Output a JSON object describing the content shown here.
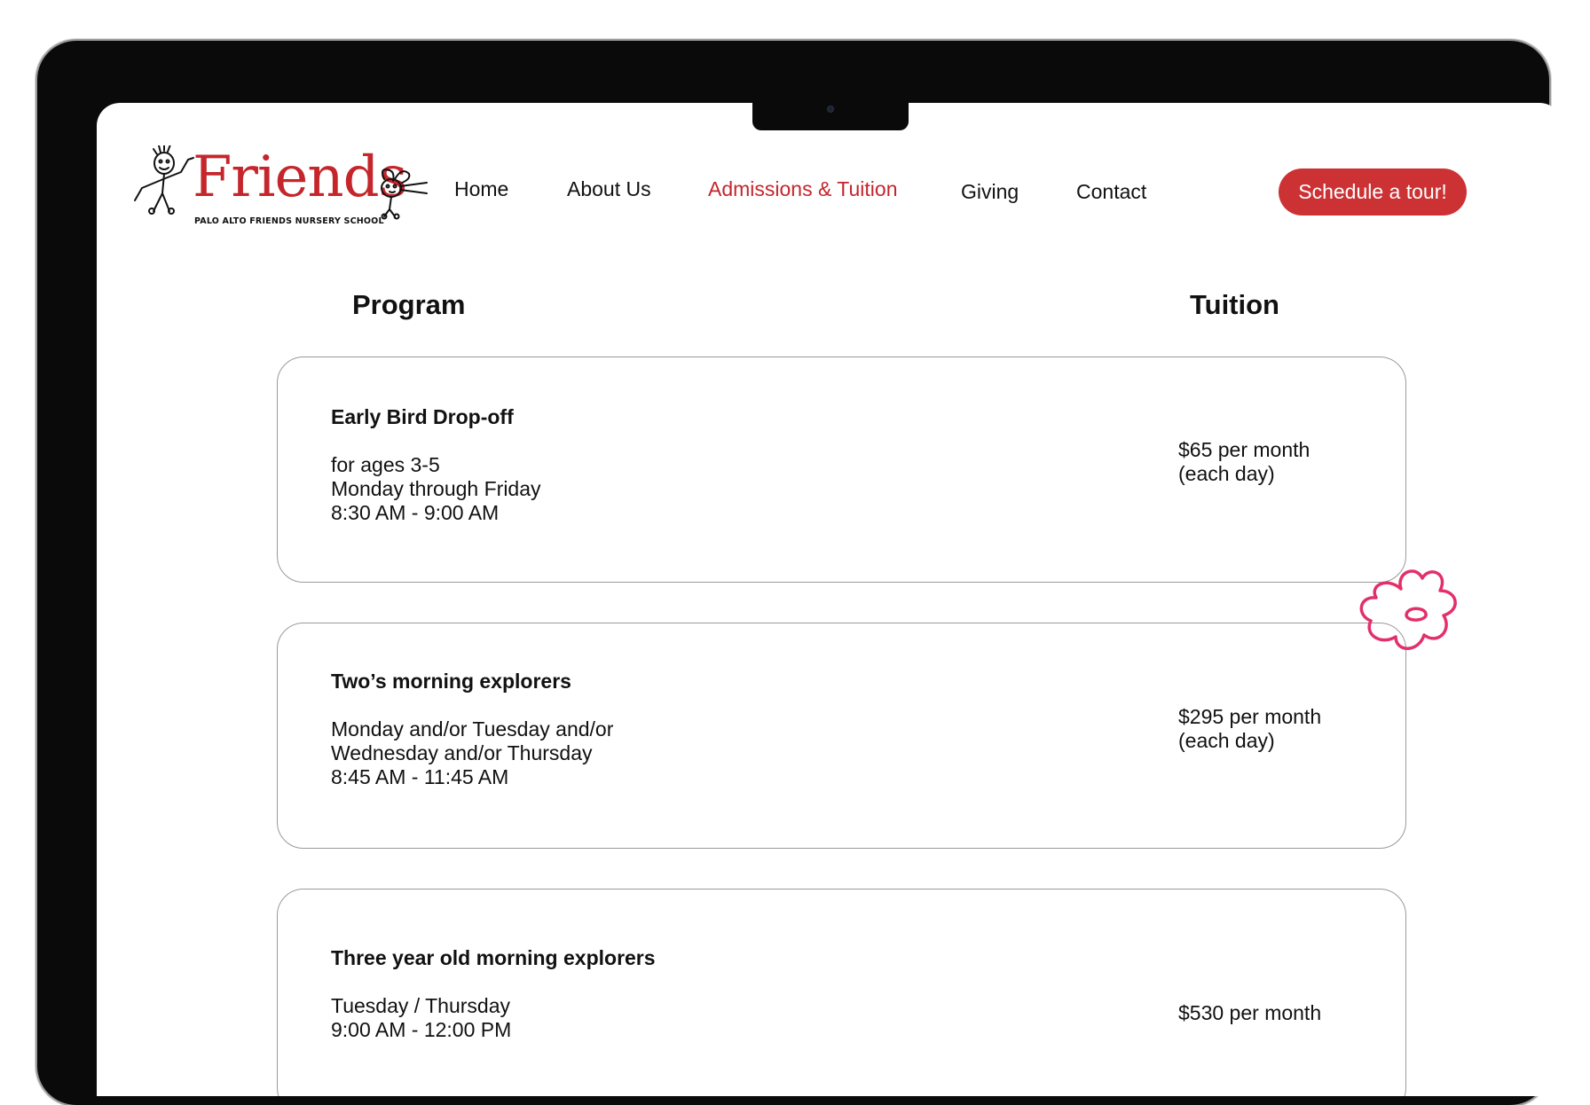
{
  "logo": {
    "word": "Friends",
    "subtitle": "PALO ALTO FRIENDS NURSERY SCHOOL"
  },
  "nav": {
    "items": [
      {
        "label": "Home"
      },
      {
        "label": "About Us"
      },
      {
        "label": "Admissions & Tuition"
      },
      {
        "label": "Giving"
      },
      {
        "label": "Contact"
      }
    ],
    "cta_label": "Schedule a tour!"
  },
  "table": {
    "program_header": "Program",
    "tuition_header": "Tuition"
  },
  "programs": [
    {
      "name": "Early Bird Drop-off",
      "lines": [
        "for ages 3-5",
        "Monday through Friday",
        "8:30 AM - 9:00 AM"
      ],
      "price_lines": [
        "$65 per month",
        "(each day)"
      ]
    },
    {
      "name": "Two’s morning explorers",
      "lines": [
        "Monday and/or Tuesday and/or",
        "Wednesday and/or Thursday",
        "8:45 AM - 11:45 AM"
      ],
      "price_lines": [
        "$295 per month",
        "(each day)"
      ]
    },
    {
      "name": "Three year old morning explorers",
      "lines": [
        "Tuesday / Thursday",
        "9:00 AM - 12:00 PM"
      ],
      "price_lines": [
        "$530 per month"
      ]
    }
  ],
  "colors": {
    "brand_red": "#c4262c",
    "cta_red": "#cc3234",
    "flower_pink": "#e2306a"
  }
}
